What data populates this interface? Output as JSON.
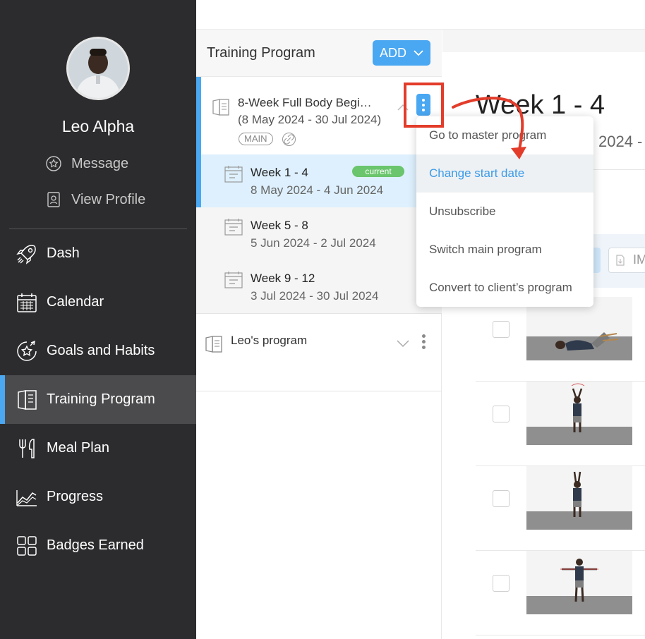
{
  "user": {
    "name": "Leo Alpha"
  },
  "profile_links": [
    {
      "label": "Message",
      "icon": "message-star-icon"
    },
    {
      "label": "View Profile",
      "icon": "profile-card-icon"
    }
  ],
  "nav": [
    {
      "label": "Dash",
      "icon": "rocket-icon"
    },
    {
      "label": "Calendar",
      "icon": "calendar-icon"
    },
    {
      "label": "Goals and Habits",
      "icon": "goal-star-icon"
    },
    {
      "label": "Training Program",
      "icon": "book-icon",
      "active": true
    },
    {
      "label": "Meal Plan",
      "icon": "fork-knife-icon"
    },
    {
      "label": "Progress",
      "icon": "progress-chart-icon"
    },
    {
      "label": "Badges Earned",
      "icon": "grid-icon"
    }
  ],
  "programs": {
    "title": "Training Program",
    "add_label": "ADD",
    "main_program": {
      "name": "8-Week Full Body Begi…",
      "dates": "(8 May 2024 - 30 Jul 2024)",
      "badge": "MAIN"
    },
    "weeks": [
      {
        "name": "Week 1 - 4",
        "dates": "8 May 2024 - 4 Jun 2024",
        "badge": "current",
        "active": true
      },
      {
        "name": "Week 5 - 8",
        "dates": "5 Jun 2024 - 2 Jul 2024"
      },
      {
        "name": "Week 9 - 12",
        "dates": "3 Jul 2024 - 30 Jul 2024"
      }
    ],
    "second_program": {
      "name": "Leo's program"
    }
  },
  "content": {
    "heading": "Week 1 - 4",
    "subdate": "2024 -",
    "tool_text": "IM"
  },
  "dropdown": {
    "items": [
      {
        "label": "Go to master program"
      },
      {
        "label": "Change start date",
        "highlighted": true
      },
      {
        "label": "Unsubscribe"
      },
      {
        "label": "Switch main program"
      },
      {
        "label": "Convert to client’s program"
      }
    ]
  },
  "colors": {
    "sidebar_bg": "#2c2c2e",
    "accent_blue": "#4aa7f2",
    "current_green": "#6ac56d",
    "annotation_red": "#e33c2a"
  }
}
